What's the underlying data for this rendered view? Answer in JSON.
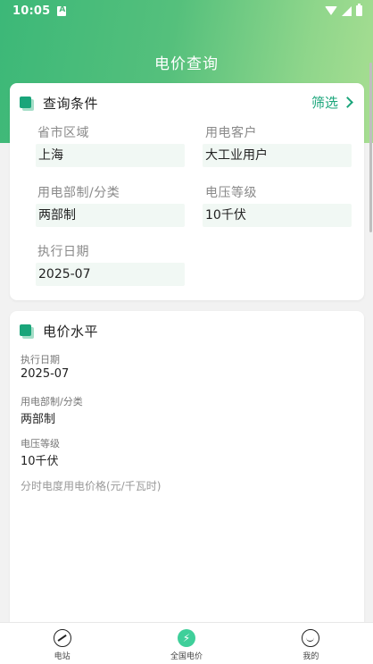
{
  "status_bar": {
    "time": "10:05"
  },
  "header": {
    "title": "电价查询"
  },
  "query_card": {
    "title": "查询条件",
    "filter_label": "筛选",
    "fields": [
      {
        "label": "省市区域",
        "value": "上海"
      },
      {
        "label": "用电客户",
        "value": "大工业用户"
      },
      {
        "label": "用电部制/分类",
        "value": "两部制"
      },
      {
        "label": "电压等级",
        "value": "10千伏"
      },
      {
        "label": "执行日期",
        "value": "2025-07"
      }
    ]
  },
  "level_card": {
    "title": "电价水平",
    "items": [
      {
        "label": "执行日期",
        "value": "2025-07"
      },
      {
        "label": "用电部制/分类",
        "value": "两部制"
      },
      {
        "label": "电压等级",
        "value": "10千伏"
      }
    ],
    "price_caption": "分时电度用电价格(元/千瓦时)"
  },
  "tabbar": {
    "tabs": [
      {
        "label": "电站",
        "icon": "chart-pulse-icon"
      },
      {
        "label": "全国电价",
        "icon": "lightning-icon"
      },
      {
        "label": "我的",
        "icon": "smile-icon"
      }
    ]
  },
  "colors": {
    "accent": "#1aa57a",
    "header_start": "#3cb878",
    "header_end": "#a8de92"
  }
}
